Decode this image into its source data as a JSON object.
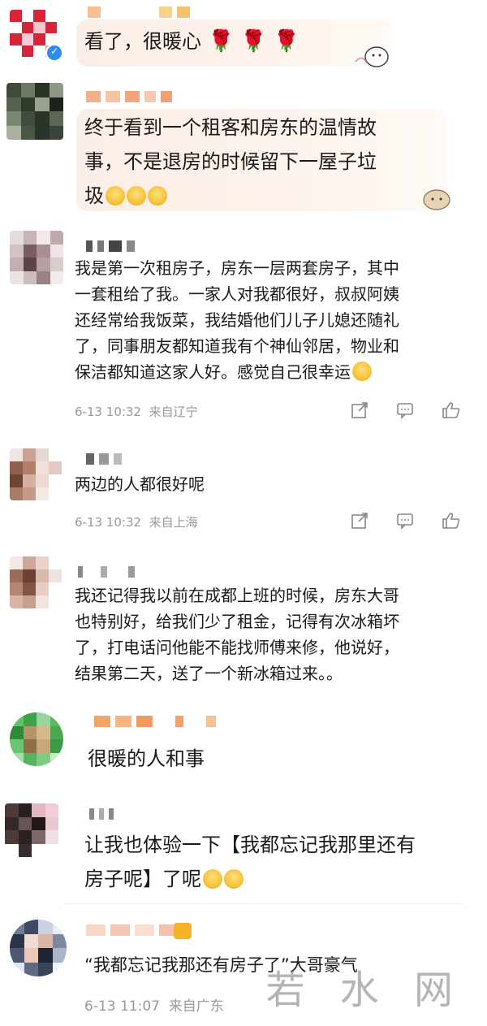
{
  "comments": [
    {
      "text": "看了，很暖心",
      "emoji": [
        "🌹",
        "🌹",
        "🌹"
      ]
    },
    {
      "text_line1": "终于看到一个租客和房东的温情故",
      "text_line2": "事，不是退房的时候留下一屋子垃",
      "text_line3": "圾"
    },
    {
      "lines": [
        "我是第一次租房子，房东一层两套房子，其中",
        "一套租给了我。一家人对我都很好，叔叔阿姨",
        "还经常给我饭菜，我结婚他们儿子儿媳还随礼",
        "了，同事朋友都知道我有个神仙邻居，物业和",
        "保洁都知道这家人好。感觉自己很幸运"
      ],
      "time": "6-13 10:32",
      "location": "来自辽宁"
    },
    {
      "text": "两边的人都很好呢",
      "time": "6-13 10:32",
      "location": "来自上海"
    },
    {
      "lines": [
        "我还记得我以前在成都上班的时候，房东大哥",
        "也特别好，给我们少了租金，记得有次冰箱坏",
        "了，打电话问他能不能找师傅来修，他说好，",
        "结果第二天，送了一个新冰箱过来。。"
      ]
    },
    {
      "text": "很暖的人和事"
    },
    {
      "line1": "让我也体验一下【我都忘记我那里还有",
      "line2": "房子呢】了呢"
    },
    {
      "text": "“我都忘记我那还有房子了”大哥豪气",
      "time": "6-13 11:07",
      "location": "来自广东"
    }
  ],
  "watermark": "若 水 网",
  "icons": [
    "share-icon",
    "comment-icon",
    "like-icon"
  ]
}
